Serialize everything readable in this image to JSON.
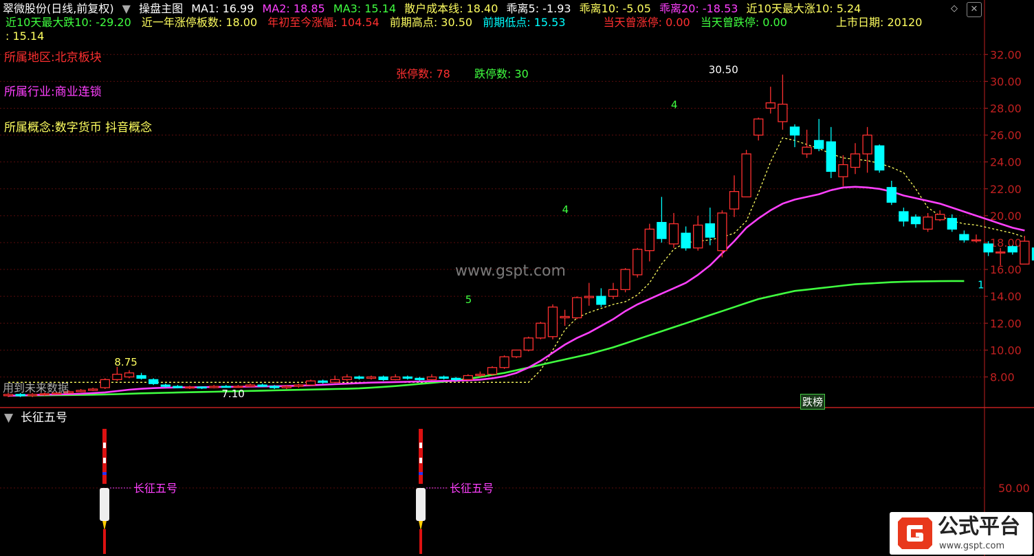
{
  "header": {
    "stock": "翠微股份(日线,前复权)",
    "panel_name": "操盘主图",
    "ma1": "MA1: 16.99",
    "ma2": "MA2: 18.85",
    "ma3": "MA3: 15.14",
    "retail_cost": "散户成本线: 18.40",
    "bias5": "乖离5: -1.93",
    "bias10": "乖离10: -5.05",
    "bias20": "乖离20: -18.53",
    "max_gain10": "近10天最大涨10: 5.24"
  },
  "header2": {
    "max_drop10": "近10天最大跌10: -29.20",
    "limit_up_year": "近一年涨停板数: 18.00",
    "ytd_change": "年初至今涨幅: 104.54",
    "prev_high": "前期高点: 30.50",
    "prev_low": "前期低点: 15.53",
    "today_limit_up": "当天曾涨停: 0.00",
    "today_limit_down": "当天曾跌停: 0.00",
    "listing_date": "上市日期: 20120",
    "wrap_value": ": 15.14"
  },
  "info": {
    "region": "所属地区:北京板块",
    "industry": "所属行业:商业连锁",
    "concept": "所属概念:数字货币 抖音概念"
  },
  "stats": {
    "limit_up": "张停数:  78",
    "limit_down": "跌停数:  30"
  },
  "annotations": {
    "peak": "30.50",
    "left_high": "8.75",
    "left_low": "7.10",
    "n5": "5",
    "n4a": "4",
    "n4b": "4",
    "n1": "1",
    "watermark": "www.gspt.com",
    "future_data": "用到未来数据",
    "drop_tag": "跌榜"
  },
  "sub_panel": {
    "title": "长征五号",
    "label1": "长征五号",
    "label2": "长征五号",
    "axis_value": "50.00"
  },
  "logo": {
    "name": "公式平台",
    "url": "www.gspt.com"
  },
  "colors": {
    "up": "#ff3030",
    "down": "#00ffff",
    "ma_magenta": "#ff40ff",
    "ma_green": "#40ff40",
    "cost_line": "#ffff60",
    "axis": "#c02020"
  },
  "chart_data": {
    "type": "candlestick",
    "y_axis_ticks": [
      "32.00",
      "30.00",
      "28.00",
      "26.00",
      "24.00",
      "22.00",
      "20.00",
      "18.00",
      "16.00",
      "14.00",
      "12.00",
      "10.00",
      "8.00"
    ],
    "ylim": [
      6.0,
      32.8
    ],
    "candles": [
      {
        "o": 6.6,
        "c": 6.7,
        "h": 6.8,
        "l": 6.5
      },
      {
        "o": 6.7,
        "c": 6.6,
        "h": 6.8,
        "l": 6.5
      },
      {
        "o": 6.6,
        "c": 6.7,
        "h": 6.8,
        "l": 6.5
      },
      {
        "o": 6.7,
        "c": 6.75,
        "h": 6.85,
        "l": 6.6
      },
      {
        "o": 6.75,
        "c": 6.8,
        "h": 6.9,
        "l": 6.7
      },
      {
        "o": 6.8,
        "c": 6.9,
        "h": 7.0,
        "l": 6.75
      },
      {
        "o": 6.9,
        "c": 7.0,
        "h": 7.1,
        "l": 6.85
      },
      {
        "o": 7.0,
        "c": 7.1,
        "h": 7.2,
        "l": 6.95
      },
      {
        "o": 7.2,
        "c": 7.8,
        "h": 7.9,
        "l": 7.1
      },
      {
        "o": 7.8,
        "c": 8.2,
        "h": 8.75,
        "l": 7.7
      },
      {
        "o": 8.0,
        "c": 8.3,
        "h": 8.5,
        "l": 7.9
      },
      {
        "o": 8.1,
        "c": 7.9,
        "h": 8.3,
        "l": 7.8
      },
      {
        "o": 7.8,
        "c": 7.5,
        "h": 7.9,
        "l": 7.4
      },
      {
        "o": 7.4,
        "c": 7.3,
        "h": 7.5,
        "l": 7.2
      },
      {
        "o": 7.3,
        "c": 7.2,
        "h": 7.4,
        "l": 7.15
      },
      {
        "o": 7.2,
        "c": 7.25,
        "h": 7.35,
        "l": 7.1
      },
      {
        "o": 7.25,
        "c": 7.2,
        "h": 7.3,
        "l": 7.1
      },
      {
        "o": 7.2,
        "c": 7.3,
        "h": 7.4,
        "l": 7.15
      },
      {
        "o": 7.3,
        "c": 7.25,
        "h": 7.4,
        "l": 7.2
      },
      {
        "o": 7.25,
        "c": 7.3,
        "h": 7.4,
        "l": 7.2
      },
      {
        "o": 7.3,
        "c": 7.4,
        "h": 7.5,
        "l": 7.25
      },
      {
        "o": 7.4,
        "c": 7.3,
        "h": 7.5,
        "l": 7.25
      },
      {
        "o": 7.3,
        "c": 7.2,
        "h": 7.4,
        "l": 7.1
      },
      {
        "o": 7.2,
        "c": 7.3,
        "h": 7.4,
        "l": 7.1
      },
      {
        "o": 7.3,
        "c": 7.4,
        "h": 7.5,
        "l": 7.2
      },
      {
        "o": 7.4,
        "c": 7.7,
        "h": 7.8,
        "l": 7.35
      },
      {
        "o": 7.7,
        "c": 7.6,
        "h": 7.8,
        "l": 7.5
      },
      {
        "o": 7.6,
        "c": 7.8,
        "h": 8.1,
        "l": 7.55
      },
      {
        "o": 7.8,
        "c": 8.0,
        "h": 8.2,
        "l": 7.7
      },
      {
        "o": 8.0,
        "c": 7.9,
        "h": 8.1,
        "l": 7.8
      },
      {
        "o": 7.9,
        "c": 8.0,
        "h": 8.1,
        "l": 7.8
      },
      {
        "o": 8.0,
        "c": 7.8,
        "h": 8.1,
        "l": 7.7
      },
      {
        "o": 7.8,
        "c": 8.0,
        "h": 8.2,
        "l": 7.75
      },
      {
        "o": 8.0,
        "c": 7.9,
        "h": 8.1,
        "l": 7.8
      },
      {
        "o": 7.9,
        "c": 7.8,
        "h": 8.0,
        "l": 7.7
      },
      {
        "o": 7.8,
        "c": 8.0,
        "h": 8.2,
        "l": 7.75
      },
      {
        "o": 8.0,
        "c": 7.9,
        "h": 8.1,
        "l": 7.8
      },
      {
        "o": 7.9,
        "c": 7.8,
        "h": 8.0,
        "l": 7.7
      },
      {
        "o": 7.8,
        "c": 8.1,
        "h": 8.2,
        "l": 7.75
      },
      {
        "o": 8.1,
        "c": 8.2,
        "h": 8.4,
        "l": 8.0
      },
      {
        "o": 8.2,
        "c": 8.7,
        "h": 8.8,
        "l": 8.1
      },
      {
        "o": 8.7,
        "c": 9.5,
        "h": 9.6,
        "l": 8.6
      },
      {
        "o": 9.5,
        "c": 10.0,
        "h": 10.0,
        "l": 9.4
      },
      {
        "o": 10.0,
        "c": 10.9,
        "h": 11.0,
        "l": 9.9
      },
      {
        "o": 10.9,
        "c": 12.0,
        "h": 12.1,
        "l": 10.8
      },
      {
        "o": 11.0,
        "c": 13.2,
        "h": 13.4,
        "l": 10.8
      },
      {
        "o": 12.4,
        "c": 12.5,
        "h": 13.0,
        "l": 11.8
      },
      {
        "o": 12.4,
        "c": 13.9,
        "h": 14.0,
        "l": 12.3
      },
      {
        "o": 13.9,
        "c": 14.0,
        "h": 15.0,
        "l": 13.3
      },
      {
        "o": 14.0,
        "c": 13.4,
        "h": 14.6,
        "l": 13.2
      },
      {
        "o": 14.0,
        "c": 14.5,
        "h": 15.0,
        "l": 13.8
      },
      {
        "o": 14.5,
        "c": 16.0,
        "h": 16.1,
        "l": 14.3
      },
      {
        "o": 15.6,
        "c": 17.5,
        "h": 17.6,
        "l": 15.4
      },
      {
        "o": 17.4,
        "c": 19.0,
        "h": 19.4,
        "l": 16.6
      },
      {
        "o": 19.5,
        "c": 18.3,
        "h": 21.4,
        "l": 18.0
      },
      {
        "o": 17.9,
        "c": 19.4,
        "h": 20.2,
        "l": 17.6
      },
      {
        "o": 18.7,
        "c": 17.6,
        "h": 19.2,
        "l": 17.4
      },
      {
        "o": 17.6,
        "c": 19.3,
        "h": 20.0,
        "l": 17.4
      },
      {
        "o": 19.4,
        "c": 18.4,
        "h": 20.6,
        "l": 17.8
      },
      {
        "o": 17.4,
        "c": 20.2,
        "h": 20.4,
        "l": 16.9
      },
      {
        "o": 20.5,
        "c": 21.8,
        "h": 23.0,
        "l": 19.9
      },
      {
        "o": 21.4,
        "c": 24.6,
        "h": 24.9,
        "l": 21.4
      },
      {
        "o": 26.0,
        "c": 27.2,
        "h": 27.3,
        "l": 25.6
      },
      {
        "o": 28.0,
        "c": 28.4,
        "h": 29.6,
        "l": 27.6
      },
      {
        "o": 27.0,
        "c": 28.3,
        "h": 30.5,
        "l": 26.4
      },
      {
        "o": 26.6,
        "c": 26.0,
        "h": 26.8,
        "l": 25.1
      },
      {
        "o": 24.6,
        "c": 25.1,
        "h": 26.4,
        "l": 24.3
      },
      {
        "o": 25.6,
        "c": 25.0,
        "h": 27.2,
        "l": 24.8
      },
      {
        "o": 25.5,
        "c": 23.3,
        "h": 26.6,
        "l": 22.8
      },
      {
        "o": 22.9,
        "c": 23.8,
        "h": 24.5,
        "l": 22.2
      },
      {
        "o": 23.6,
        "c": 24.6,
        "h": 25.4,
        "l": 23.1
      },
      {
        "o": 24.6,
        "c": 26.0,
        "h": 26.6,
        "l": 23.2
      },
      {
        "o": 25.2,
        "c": 23.4,
        "h": 25.3,
        "l": 23.2
      },
      {
        "o": 22.1,
        "c": 21.0,
        "h": 22.6,
        "l": 20.8
      },
      {
        "o": 20.3,
        "c": 19.6,
        "h": 20.6,
        "l": 19.2
      },
      {
        "o": 19.9,
        "c": 19.4,
        "h": 20.1,
        "l": 19.1
      },
      {
        "o": 19.0,
        "c": 19.9,
        "h": 20.2,
        "l": 18.8
      },
      {
        "o": 19.7,
        "c": 20.1,
        "h": 20.4,
        "l": 19.6
      },
      {
        "o": 19.8,
        "c": 19.0,
        "h": 20.1,
        "l": 18.8
      },
      {
        "o": 18.6,
        "c": 18.2,
        "h": 18.9,
        "l": 18.0
      },
      {
        "o": 18.2,
        "c": 18.2,
        "h": 18.6,
        "l": 18.0
      },
      {
        "o": 17.9,
        "c": 17.3,
        "h": 18.1,
        "l": 17.0
      },
      {
        "o": 17.3,
        "c": 17.3,
        "h": 17.6,
        "l": 16.3
      },
      {
        "o": 17.7,
        "c": 17.3,
        "h": 17.8,
        "l": 17.1
      },
      {
        "o": 16.4,
        "c": 18.1,
        "h": 18.5,
        "l": 16.4
      },
      {
        "o": 17.6,
        "c": 16.7,
        "h": 17.8,
        "l": 16.5
      },
      {
        "o": 16.8,
        "c": 16.3,
        "h": 17.0,
        "l": 16.0
      },
      {
        "o": 16.3,
        "c": 16.7,
        "h": 16.8,
        "l": 15.5
      }
    ],
    "ma_magenta": [
      6.6,
      6.62,
      6.65,
      6.68,
      6.7,
      6.72,
      6.75,
      6.8,
      6.85,
      6.95,
      7.05,
      7.12,
      7.17,
      7.2,
      7.22,
      7.23,
      7.24,
      7.25,
      7.26,
      7.27,
      7.28,
      7.29,
      7.3,
      7.32,
      7.35,
      7.38,
      7.42,
      7.46,
      7.5,
      7.54,
      7.58,
      7.6,
      7.62,
      7.64,
      7.66,
      7.68,
      7.7,
      7.72,
      7.75,
      7.8,
      7.9,
      8.05,
      8.3,
      8.7,
      9.2,
      9.8,
      10.4,
      10.9,
      11.3,
      11.8,
      12.3,
      12.9,
      13.4,
      13.8,
      14.2,
      14.6,
      15.0,
      15.6,
      16.3,
      17.2,
      18.1,
      19.1,
      19.8,
      20.4,
      20.9,
      21.2,
      21.4,
      21.6,
      21.9,
      22.1,
      22.15,
      22.1,
      22.0,
      21.8,
      21.5,
      21.3,
      21.1,
      20.9,
      20.6,
      20.3,
      20.0,
      19.7,
      19.4,
      19.1,
      18.9
    ],
    "ma_green": [
      6.6,
      6.61,
      6.62,
      6.63,
      6.64,
      6.65,
      6.66,
      6.68,
      6.7,
      6.72,
      6.75,
      6.78,
      6.8,
      6.82,
      6.84,
      6.86,
      6.88,
      6.9,
      6.92,
      6.94,
      6.96,
      6.98,
      7.0,
      7.02,
      7.04,
      7.06,
      7.08,
      7.1,
      7.12,
      7.15,
      7.2,
      7.26,
      7.32,
      7.4,
      7.48,
      7.56,
      7.65,
      7.75,
      7.86,
      8.0,
      8.15,
      8.3,
      8.5,
      8.7,
      8.9,
      9.1,
      9.3,
      9.5,
      9.7,
      9.95,
      10.2,
      10.5,
      10.8,
      11.1,
      11.4,
      11.7,
      12.0,
      12.3,
      12.6,
      12.9,
      13.2,
      13.5,
      13.8,
      14.0,
      14.2,
      14.4,
      14.5,
      14.6,
      14.7,
      14.8,
      14.9,
      14.95,
      15.0,
      15.05,
      15.08,
      15.1,
      15.12,
      15.13,
      15.14,
      15.14
    ],
    "cost_line": [
      7.6,
      7.6,
      7.6,
      7.6,
      7.6,
      7.6,
      7.6,
      7.6,
      7.6,
      7.6,
      7.6,
      7.6,
      7.6,
      7.6,
      7.6,
      7.6,
      7.6,
      7.6,
      7.6,
      7.6,
      7.6,
      7.6,
      7.6,
      7.6,
      7.6,
      7.6,
      7.6,
      7.6,
      7.6,
      7.6,
      7.6,
      7.6,
      7.6,
      7.6,
      7.6,
      7.6,
      7.6,
      7.6,
      7.6,
      7.6,
      7.6,
      7.6,
      7.6,
      7.6,
      8.5,
      10.0,
      11.5,
      12.4,
      12.8,
      13.1,
      13.4,
      13.6,
      14.1,
      15.0,
      16.4,
      17.5,
      18.0,
      18.1,
      18.2,
      18.4,
      18.7,
      19.6,
      21.7,
      24.0,
      25.8,
      25.6,
      25.3,
      25.0,
      24.6,
      24.3,
      24.2,
      24.1,
      23.9,
      23.6,
      23.2,
      22.0,
      20.6,
      20.0,
      19.6,
      19.4,
      19.3,
      19.1,
      18.9,
      18.7,
      18.4
    ]
  }
}
